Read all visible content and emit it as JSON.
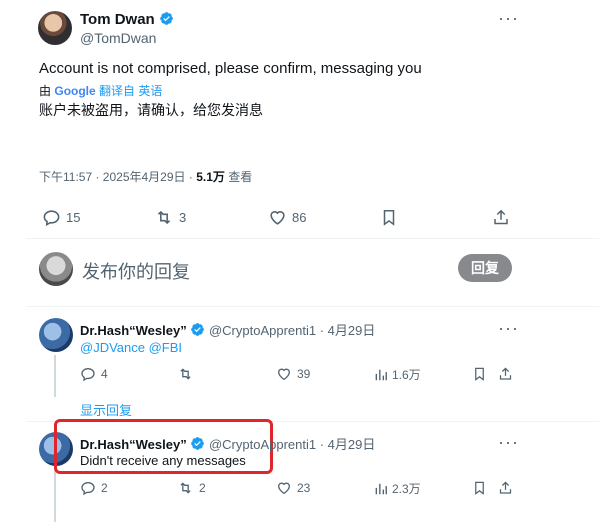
{
  "tweet": {
    "author_name": "Tom Dwan",
    "author_handle": "@TomDwan",
    "text": "Account is not comprised, please confirm, messaging you",
    "translate_prefix": "由",
    "translate_google": "Google",
    "translate_suffix": "翻译自 英语",
    "translated_text": "账户未被盗用，请确认，给您发消息",
    "timestamp": "下午11:57 · 2025年4月29日 · ",
    "views_count": "5.1万",
    "views_label": " 查看",
    "replies": "15",
    "retweets": "3",
    "likes": "86"
  },
  "composer": {
    "placeholder": "发布你的回复",
    "reply_button": "回复"
  },
  "replies": [
    {
      "name": "Dr.Hash“Wesley”",
      "handle": "@CryptoApprenti1",
      "date": "· 4月29日",
      "text_mentions": "@JDVance @FBI",
      "replies": "4",
      "retweets": "",
      "likes": "39",
      "views": "1.6万"
    },
    {
      "name": "Dr.Hash“Wesley”",
      "handle": "@CryptoApprenti1",
      "date": "· 4月29日",
      "text": "Didn't receive any messages",
      "replies": "2",
      "retweets": "2",
      "likes": "23",
      "views": "2.3万"
    }
  ],
  "show_replies": "显示回复",
  "colors": {
    "accent": "#1d9bf0",
    "text": "#0f1419",
    "muted": "#536471",
    "highlight_box": "#e0262d",
    "button_bg": "#87898c"
  }
}
